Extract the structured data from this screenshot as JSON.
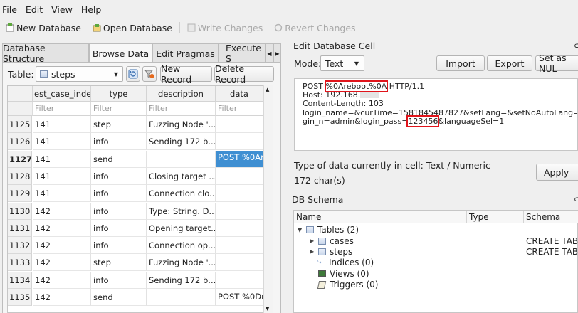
{
  "menubar": [
    "File",
    "Edit",
    "View",
    "Help"
  ],
  "toolbar": {
    "new_db": "New Database",
    "open_db": "Open Database",
    "write": "Write Changes",
    "revert": "Revert Changes"
  },
  "tabs": [
    "Database Structure",
    "Browse Data",
    "Edit Pragmas",
    "Execute S"
  ],
  "browse": {
    "table_label": "Table:",
    "table_value": "steps",
    "new_record": "New Record",
    "delete_record": "Delete Record",
    "columns": [
      "est_case_inde»",
      "type",
      "description",
      "data"
    ],
    "filter": "Filter",
    "rows": [
      {
        "id": "1125",
        "case": "141",
        "type": "step",
        "desc": "Fuzzing Node '...",
        "data": ""
      },
      {
        "id": "1126",
        "case": "141",
        "type": "info",
        "desc": "Sending 172 b...",
        "data": ""
      },
      {
        "id": "1127",
        "case": "141",
        "type": "send",
        "desc": "",
        "data": "POST %0Ar..."
      },
      {
        "id": "1128",
        "case": "141",
        "type": "info",
        "desc": "Closing target ...",
        "data": ""
      },
      {
        "id": "1129",
        "case": "141",
        "type": "info",
        "desc": "Connection clo...",
        "data": ""
      },
      {
        "id": "1130",
        "case": "142",
        "type": "info",
        "desc": "Type: String. D...",
        "data": ""
      },
      {
        "id": "1131",
        "case": "142",
        "type": "info",
        "desc": "Opening target...",
        "data": ""
      },
      {
        "id": "1132",
        "case": "142",
        "type": "info",
        "desc": "Connection op...",
        "data": ""
      },
      {
        "id": "1133",
        "case": "142",
        "type": "step",
        "desc": "Fuzzing Node '...",
        "data": ""
      },
      {
        "id": "1134",
        "case": "142",
        "type": "info",
        "desc": "Sending 172 b...",
        "data": ""
      },
      {
        "id": "1135",
        "case": "142",
        "type": "send",
        "desc": "",
        "data": "POST %0Dr..."
      }
    ]
  },
  "edit_cell": {
    "title": "Edit Database Cell",
    "mode_label": "Mode:",
    "mode_value": "Text",
    "import": "Import",
    "export": "Export",
    "set_null": "Set as NUL",
    "line1_pre": "POST ",
    "line1_hl": "%0Areboot%0A",
    "line1_post": " HTTP/1.1",
    "line2": "Host: 192.168.",
    "line3": "Content-Length: 103",
    "line4": "login_name=&curTime=1581845487827&setLang=&setNoAutoLang=&lo",
    "line5_pre": "gin_n=admin&login_pass=",
    "line5_hl": "123456",
    "line5_post": "&languageSel=1",
    "type_info": "Type of data currently in cell: Text / Numeric",
    "chars": "172 char(s)",
    "apply": "Apply"
  },
  "schema": {
    "title": "DB Schema",
    "cols": [
      "Name",
      "Type",
      "Schema"
    ],
    "items": [
      {
        "label": "Tables (2)",
        "schema": ""
      },
      {
        "label": "cases",
        "schema": "CREATE TAB"
      },
      {
        "label": "steps",
        "schema": "CREATE TAB"
      },
      {
        "label": "Indices (0)",
        "schema": ""
      },
      {
        "label": "Views (0)",
        "schema": ""
      },
      {
        "label": "Triggers (0)",
        "schema": ""
      }
    ]
  }
}
